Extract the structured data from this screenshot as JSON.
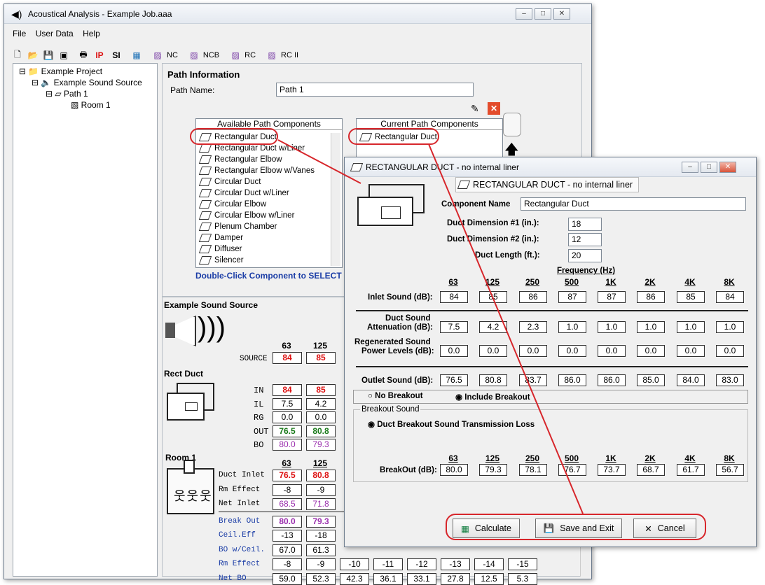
{
  "main_window": {
    "title": "Acoustical Analysis - Example Job.aaa",
    "menu": [
      "File",
      "User Data",
      "Help"
    ],
    "toolbar": {
      "ip": "IP",
      "si": "SI",
      "nc": "NC",
      "ncb": "NCB",
      "rc": "RC",
      "rc2": "RC II"
    }
  },
  "tree": {
    "project": "Example Project",
    "source": "Example Sound Source",
    "path": "Path 1",
    "room": "Room 1"
  },
  "path_info": {
    "heading": "Path Information",
    "name_label": "Path Name:",
    "name_value": "Path 1"
  },
  "available": {
    "header": "Available Path Components",
    "items": [
      "Rectangular Duct",
      "Rectangular Duct w/Liner",
      "Rectangular Elbow",
      "Rectangular Elbow w/Vanes",
      "Circular Duct",
      "Circular Duct w/Liner",
      "Circular Elbow",
      "Circular Elbow w/Liner",
      "Plenum Chamber",
      "Damper",
      "Diffuser",
      "Silencer"
    ],
    "hint": "Double-Click Component to SELECT"
  },
  "current": {
    "header": "Current Path Components",
    "items": [
      "Rectangular Duct"
    ]
  },
  "source_panel": {
    "title": "Example Sound Source",
    "freqs": [
      "63",
      "125"
    ],
    "row_label": "SOURCE",
    "values": [
      "84",
      "85"
    ]
  },
  "rect_duct_panel": {
    "title": "Rect Duct",
    "rows": [
      {
        "label": "IN",
        "v": [
          "84",
          "85"
        ]
      },
      {
        "label": "IL",
        "v": [
          "7.5",
          "4.2"
        ]
      },
      {
        "label": "RG",
        "v": [
          "0.0",
          "0.0"
        ]
      },
      {
        "label": "OUT",
        "v": [
          "76.5",
          "80.8"
        ]
      },
      {
        "label": "BO",
        "v": [
          "80.0",
          "79.3"
        ]
      }
    ]
  },
  "room_panel": {
    "title": "Room 1",
    "freqs": [
      "63",
      "125"
    ],
    "rows": [
      {
        "label": "Duct Inlet",
        "v": [
          "76.5",
          "80.8"
        ]
      },
      {
        "label": "Rm Effect",
        "v": [
          "-8",
          "-9"
        ]
      },
      {
        "label": "Net Inlet",
        "v": [
          "68.5",
          "71.8"
        ]
      },
      {
        "label": "Break Out",
        "v": [
          "80.0",
          "79.3"
        ]
      },
      {
        "label": "Ceil.Eff",
        "v": [
          "-13",
          "-18"
        ]
      },
      {
        "label": "BO w/Ceil.",
        "v": [
          "67.0",
          "61.3"
        ]
      },
      {
        "label": "Rm Effect",
        "v": [
          "-8",
          "-9",
          "-10",
          "-11",
          "-12",
          "-13",
          "-14",
          "-15"
        ]
      },
      {
        "label": "Net BO",
        "v": [
          "59.0",
          "52.3",
          "42.3",
          "36.1",
          "33.1",
          "27.8",
          "12.5",
          "5.3"
        ]
      }
    ]
  },
  "dialog": {
    "title": "RECTANGULAR DUCT - no internal liner",
    "subtitle": "RECTANGULAR DUCT - no internal liner",
    "component_name_label": "Component Name",
    "component_name": "Rectangular Duct",
    "dim1_label": "Duct Dimension #1 (in.):",
    "dim1": "18",
    "dim2_label": "Duct Dimension #2 (in.):",
    "dim2": "12",
    "length_label": "Duct Length (ft.):",
    "length": "20",
    "freq_title": "Frequency (Hz)",
    "freqs": [
      "63",
      "125",
      "250",
      "500",
      "1K",
      "2K",
      "4K",
      "8K"
    ],
    "inlet_label": "Inlet Sound (dB):",
    "inlet": [
      "84",
      "85",
      "86",
      "87",
      "87",
      "86",
      "85",
      "84"
    ],
    "atten_label1": "Duct Sound",
    "atten_label2": "Attenuation (dB):",
    "atten": [
      "7.5",
      "4.2",
      "2.3",
      "1.0",
      "1.0",
      "1.0",
      "1.0",
      "1.0"
    ],
    "regen_label1": "Regenerated Sound",
    "regen_label2": "Power Levels (dB):",
    "regen": [
      "0.0",
      "0.0",
      "0.0",
      "0.0",
      "0.0",
      "0.0",
      "0.0",
      "0.0"
    ],
    "outlet_label": "Outlet Sound (dB):",
    "outlet": [
      "76.5",
      "80.8",
      "83.7",
      "86.0",
      "86.0",
      "85.0",
      "84.0",
      "83.0"
    ],
    "no_breakout": "No Breakout",
    "include_breakout": "Include Breakout",
    "breakout_group": "Breakout Sound",
    "breakout_tl": "Duct Breakout Sound Transmission Loss",
    "breakout_label": "BreakOut  (dB):",
    "breakout": [
      "80.0",
      "79.3",
      "78.1",
      "76.7",
      "73.7",
      "68.7",
      "61.7",
      "56.7"
    ],
    "calculate": "Calculate",
    "save_exit": "Save and Exit",
    "cancel": "Cancel"
  },
  "colors": {
    "callout": "#d7262b",
    "value_red": "#d11111",
    "value_green": "#1a7a1a",
    "value_purple": "#9b2fae",
    "label_blue": "#1b3da6"
  }
}
